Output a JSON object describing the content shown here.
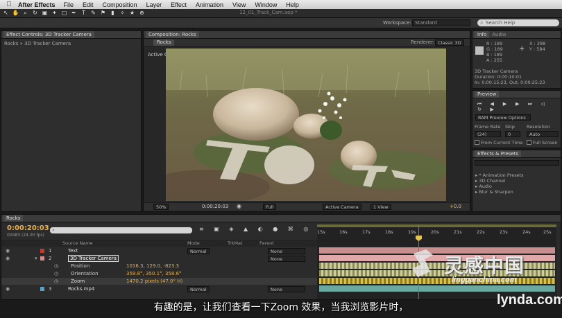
{
  "menubar": {
    "app": "After Effects",
    "items": [
      "File",
      "Edit",
      "Composition",
      "Layer",
      "Effect",
      "Animation",
      "View",
      "Window",
      "Help"
    ]
  },
  "document_title": "12_01_Track_Cam.aep *",
  "workspace": {
    "label": "Workspace:",
    "value": "Standard"
  },
  "search_placeholder": "Search Help",
  "effect_controls": {
    "tab": "Effect Controls: 3D Tracker Camera",
    "subtitle": "Rocks » 3D Tracker Camera"
  },
  "composition": {
    "tab": "Composition: Rocks",
    "pill": "Rocks",
    "renderer_label": "Renderer:",
    "renderer_value": "Classic 3D",
    "view_label": "Active Camera",
    "footer": {
      "zoom": "50%",
      "timecode": "0:00:20:03",
      "resolution": "Full",
      "camera": "Active Camera",
      "views": "1 View",
      "exposure": "+0.0"
    }
  },
  "info": {
    "tabs": [
      "Info",
      "Audio"
    ],
    "rgb": [
      "R : 189",
      "G : 189",
      "B : 189",
      "A : 255"
    ],
    "xy": [
      "X : 398",
      "Y : 584"
    ],
    "layer": "3D Tracker Camera",
    "duration": "Duration: 0:00:10:01",
    "inout": "In: 0:00:15:23, Out: 0:00:25:23"
  },
  "preview": {
    "tab": "Preview",
    "ram_options": "RAM Preview Options",
    "frame_rate_label": "Frame Rate",
    "skip_label": "Skip",
    "resolution_label": "Resolution",
    "frame_rate": "(24)",
    "skip": "0",
    "resolution": "Auto",
    "from_current": "From Current Time",
    "full_screen": "Full Screen"
  },
  "effects_presets": {
    "tab": "Effects & Presets",
    "items": [
      "* Animation Presets",
      "3D Channel",
      "Audio",
      "Blur & Sharpen"
    ]
  },
  "timeline": {
    "tab": "Rocks",
    "timecode": "0:00:20:03",
    "fps": "00483 (24.00 fps)",
    "columns": {
      "source": "Source Name",
      "mode": "Mode",
      "trkmat": "TrkMat",
      "parent": "Parent"
    },
    "layers": [
      {
        "num": "1",
        "name": "Text",
        "mode": "",
        "parent": "None",
        "color": "#c0392b"
      },
      {
        "num": "2",
        "name": "3D Tracker Camera",
        "mode": "",
        "parent": "None",
        "color": "#d98c8c"
      },
      {
        "num": "3",
        "name": "Rocks.mp4",
        "mode": "Normal",
        "parent": "None",
        "color": "#5aa0c8"
      }
    ],
    "text_mode": "Normal",
    "props": [
      {
        "name": "Position",
        "value": "1016.3, 129.0, -823.3"
      },
      {
        "name": "Orientation",
        "value": "359.8°, 350.1°, 358.6°"
      },
      {
        "name": "Zoom",
        "value": "1470.2 pixels (47.0° H)"
      }
    ],
    "ticks": [
      "15s",
      "16s",
      "17s",
      "18s",
      "19s",
      "20s",
      "21s",
      "22s",
      "23s",
      "24s",
      "25s"
    ]
  },
  "subtitle": "有趣的是，让我们查看一下Zoom 效果，当我浏览影片时，",
  "watermark": {
    "cn": "灵感中国",
    "url": "lingganchina.com",
    "brand": "lynda.com"
  }
}
